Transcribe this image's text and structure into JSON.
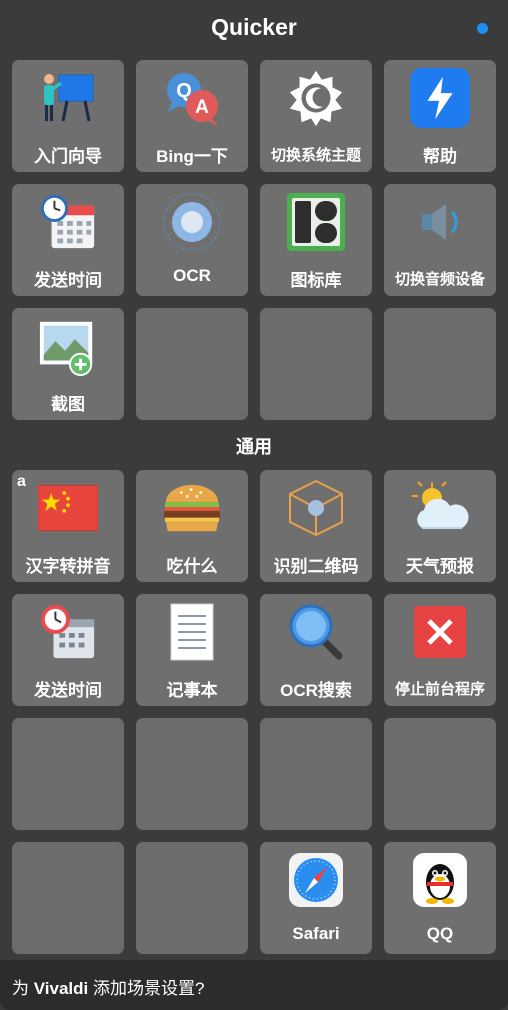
{
  "app": {
    "title": "Quicker"
  },
  "colors": {
    "status_dot": "#1f8ef1",
    "tile_bg": "#6f6f6f",
    "window_bg": "#3b3b3b"
  },
  "top_grid": [
    {
      "label": "入门向导",
      "icon": "presentation-board-icon"
    },
    {
      "label": "Bing一下",
      "icon": "qa-bubbles-icon"
    },
    {
      "label": "切换系统主题",
      "icon": "theme-gear-moon-icon"
    },
    {
      "label": "帮助",
      "icon": "lightning-app-icon"
    },
    {
      "label": "发送时间",
      "icon": "calendar-clock-icon"
    },
    {
      "label": "OCR",
      "icon": "ocr-target-icon"
    },
    {
      "label": "图标库",
      "icon": "icon-library-icon"
    },
    {
      "label": "切换音频设备",
      "icon": "speaker-icon"
    },
    {
      "label": "截图",
      "icon": "image-add-icon"
    },
    {
      "label": "",
      "icon": ""
    },
    {
      "label": "",
      "icon": ""
    },
    {
      "label": "",
      "icon": ""
    }
  ],
  "section": {
    "title": "通用"
  },
  "common_grid": [
    {
      "label": "汉字转拼音",
      "icon": "china-flag-icon",
      "corner": "a"
    },
    {
      "label": "吃什么",
      "icon": "burger-icon"
    },
    {
      "label": "识别二维码",
      "icon": "cube-icon"
    },
    {
      "label": "天气预报",
      "icon": "weather-icon"
    },
    {
      "label": "发送时间",
      "icon": "calendar-clock-icon"
    },
    {
      "label": "记事本",
      "icon": "notepad-icon"
    },
    {
      "label": "OCR搜索",
      "icon": "magnifier-icon"
    },
    {
      "label": "停止前台程序",
      "icon": "close-icon"
    },
    {
      "label": "",
      "icon": ""
    },
    {
      "label": "",
      "icon": ""
    },
    {
      "label": "",
      "icon": ""
    },
    {
      "label": "",
      "icon": ""
    },
    {
      "label": "",
      "icon": ""
    },
    {
      "label": "",
      "icon": ""
    },
    {
      "label": "Safari",
      "icon": "safari-icon"
    },
    {
      "label": "QQ",
      "icon": "qq-penguin-icon"
    }
  ],
  "footer": {
    "prefix": "为 ",
    "app_name": "Vivaldi",
    "suffix": " 添加场景设置?"
  }
}
